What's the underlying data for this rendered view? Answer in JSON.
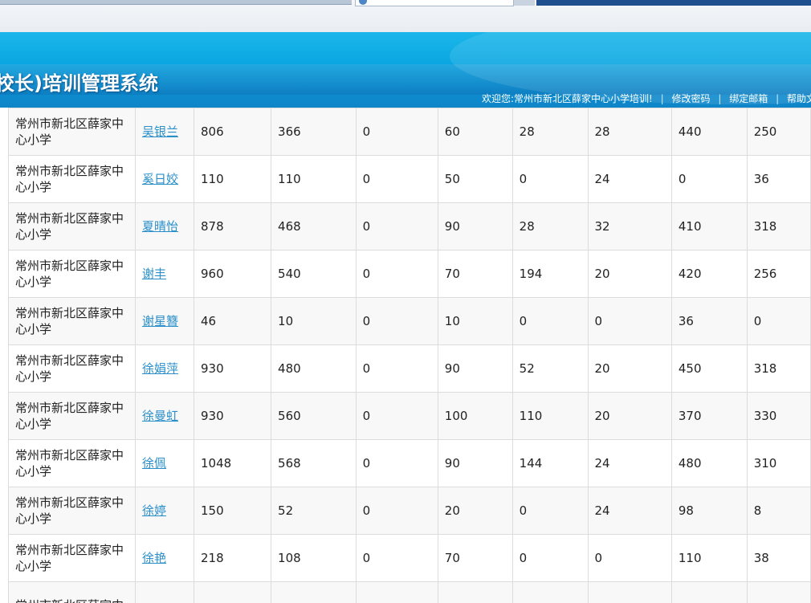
{
  "header": {
    "title": "校长)培训管理系统",
    "welcome": "欢迎您:常州市新北区薛家中心小学培训!",
    "links": [
      "修改密码",
      "绑定邮箱",
      "帮助文"
    ]
  },
  "table": {
    "rows": [
      {
        "school": "常州市新北区薛家中心小学",
        "name": "吴银兰",
        "values": [
          "806",
          "366",
          "0",
          "60",
          "28",
          "28",
          "440",
          "250"
        ]
      },
      {
        "school": "常州市新北区薛家中心小学",
        "name": "奚日姣",
        "values": [
          "110",
          "110",
          "0",
          "50",
          "0",
          "24",
          "0",
          "36"
        ]
      },
      {
        "school": "常州市新北区薛家中心小学",
        "name": "夏晴怡",
        "values": [
          "878",
          "468",
          "0",
          "90",
          "28",
          "32",
          "410",
          "318"
        ]
      },
      {
        "school": "常州市新北区薛家中心小学",
        "name": "谢丰",
        "values": [
          "960",
          "540",
          "0",
          "70",
          "194",
          "20",
          "420",
          "256"
        ]
      },
      {
        "school": "常州市新北区薛家中心小学",
        "name": "谢星簪",
        "values": [
          "46",
          "10",
          "0",
          "10",
          "0",
          "0",
          "36",
          "0"
        ]
      },
      {
        "school": "常州市新北区薛家中心小学",
        "name": "徐娟萍",
        "values": [
          "930",
          "480",
          "0",
          "90",
          "52",
          "20",
          "450",
          "318"
        ]
      },
      {
        "school": "常州市新北区薛家中心小学",
        "name": "徐曼虹",
        "values": [
          "930",
          "560",
          "0",
          "100",
          "110",
          "20",
          "370",
          "330"
        ]
      },
      {
        "school": "常州市新北区薛家中心小学",
        "name": "徐佩",
        "values": [
          "1048",
          "568",
          "0",
          "90",
          "144",
          "24",
          "480",
          "310"
        ]
      },
      {
        "school": "常州市新北区薛家中心小学",
        "name": "徐婷",
        "values": [
          "150",
          "52",
          "0",
          "20",
          "0",
          "24",
          "98",
          "8"
        ]
      },
      {
        "school": "常州市新北区薛家中心小学",
        "name": "徐艳",
        "values": [
          "218",
          "108",
          "0",
          "70",
          "0",
          "0",
          "110",
          "38"
        ]
      },
      {
        "school": "常州市新北区薛家中",
        "name": "",
        "values": [
          "",
          "",
          "",
          "",
          "",
          "",
          "",
          ""
        ]
      }
    ]
  }
}
